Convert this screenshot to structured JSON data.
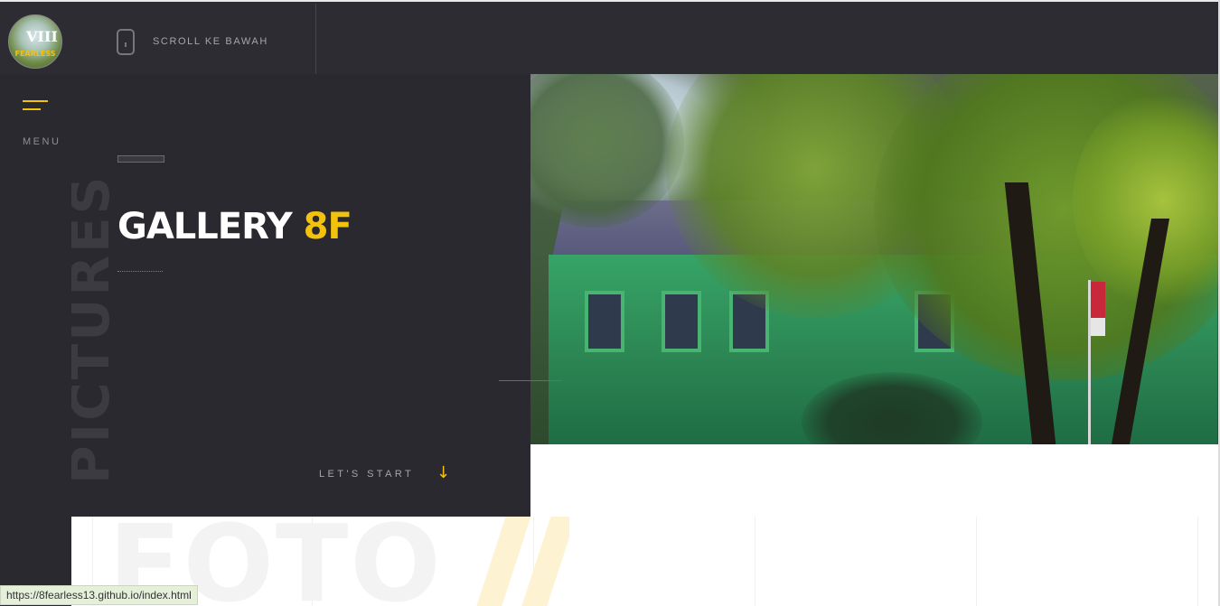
{
  "header": {
    "logo_text": "FEARLESS",
    "logo_mark": "VIII",
    "scroll_label": "SCROLL KE BAWAH"
  },
  "menu": {
    "label": "MENU"
  },
  "hero": {
    "vertical_word": "PICTURES",
    "title_main": "GALLERY",
    "title_accent": "8F",
    "cta_label": "LET'S START",
    "cta_arrow": "↓"
  },
  "section": {
    "background_word": "FOTO"
  },
  "status_bar": {
    "url": "https://8fearless13.github.io/index.html"
  },
  "colors": {
    "accent": "#f2c20c",
    "dark_bg": "#2a292f",
    "header_bg": "#2d2c32"
  },
  "icons": [
    "menu-icon",
    "mouse-scroll-icon",
    "arrow-down-icon"
  ]
}
